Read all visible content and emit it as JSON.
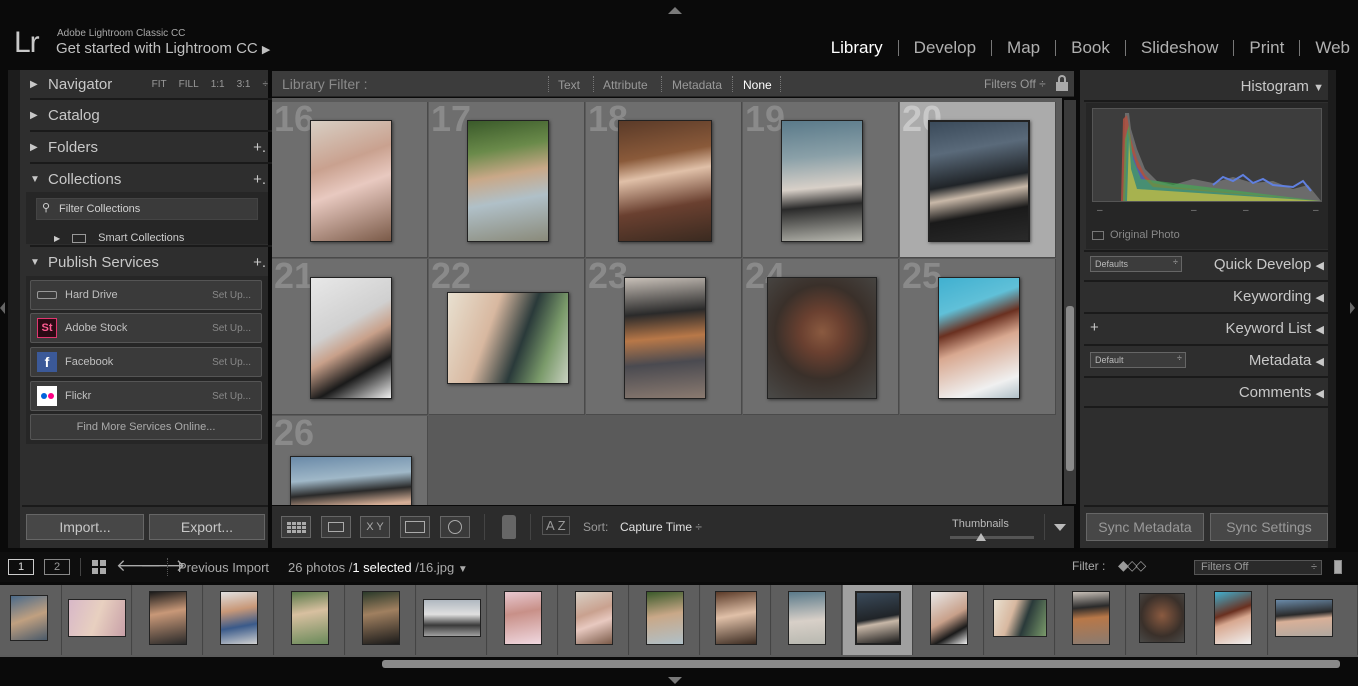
{
  "app": {
    "logo": "Lr",
    "name": "Adobe Lightroom Classic CC",
    "tagline": "Get started with Lightroom CC",
    "tagline_arrow": "▶"
  },
  "modules": [
    "Library",
    "Develop",
    "Map",
    "Book",
    "Slideshow",
    "Print",
    "Web"
  ],
  "active_module": "Library",
  "left_panel": {
    "navigator": {
      "label": "Navigator",
      "options": [
        "FIT",
        "FILL",
        "1:1",
        "3:1"
      ]
    },
    "catalog": "Catalog",
    "folders": "Folders",
    "collections": "Collections",
    "filter_collections": "Filter Collections",
    "smart_collections": "Smart Collections",
    "publish_services": "Publish Services",
    "services": [
      {
        "name": "Hard Drive",
        "action": "Set Up...",
        "icon": "hard-drive-icon"
      },
      {
        "name": "Adobe Stock",
        "action": "Set Up...",
        "icon": "adobe-stock-icon",
        "glyph": "St"
      },
      {
        "name": "Facebook",
        "action": "Set Up...",
        "icon": "facebook-icon",
        "glyph": "f"
      },
      {
        "name": "Flickr",
        "action": "Set Up...",
        "icon": "flickr-icon"
      }
    ],
    "find_more": "Find More Services Online...",
    "import_label": "Import...",
    "export_label": "Export..."
  },
  "filter_bar": {
    "label": "Library Filter :",
    "options": [
      "Text",
      "Attribute",
      "Metadata",
      "None"
    ],
    "active": "None",
    "filters_off": "Filters Off ÷"
  },
  "grid": {
    "cells": [
      {
        "num": "16"
      },
      {
        "num": "17"
      },
      {
        "num": "18"
      },
      {
        "num": "19"
      },
      {
        "num": "20",
        "selected": true
      },
      {
        "num": "21"
      },
      {
        "num": "22"
      },
      {
        "num": "23"
      },
      {
        "num": "24"
      },
      {
        "num": "25"
      },
      {
        "num": "26"
      }
    ]
  },
  "toolbar": {
    "sort_label": "Sort:",
    "sort_value": "Capture Time",
    "sort_arrow": "÷",
    "thumbnails_label": "Thumbnails",
    "az": "A Z",
    "xy": "X Y"
  },
  "right_panel": {
    "histogram": "Histogram",
    "original_photo": "Original Photo",
    "quick_develop": "Quick Develop",
    "quick_develop_preset": "Defaults",
    "keywording": "Keywording",
    "keyword_list": "Keyword List",
    "metadata": "Metadata",
    "metadata_preset": "Default",
    "comments": "Comments",
    "sync_metadata": "Sync Metadata",
    "sync_settings": "Sync Settings",
    "histogram_ticks": [
      "–",
      "–",
      "–",
      "–"
    ]
  },
  "filmstrip": {
    "view1": "1",
    "view2": "2",
    "source": "Previous Import",
    "count_prefix": "26 photos /",
    "selected": "1 selected",
    "file": "/16.jpg",
    "filter_label": "Filter :",
    "filter_value": "Filters Off"
  },
  "colors": {
    "bg": "#0a0a0a",
    "panel": "#2e2e2e",
    "grid": "#6e6e6e",
    "selected_cell": "#ababab",
    "adobe_stock": "#e0366f",
    "facebook": "#3b5998"
  }
}
